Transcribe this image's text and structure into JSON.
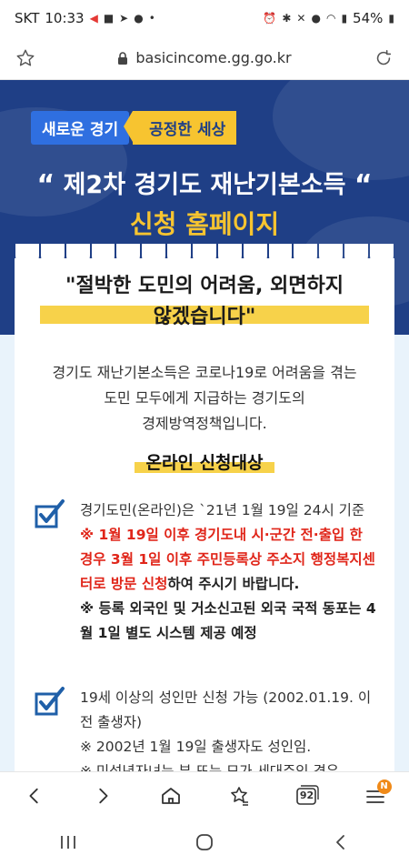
{
  "status_bar": {
    "carrier": "SKT",
    "time": "10:33",
    "battery": "54%"
  },
  "browser": {
    "url": "basicincome.gg.go.kr",
    "tab_count": "92",
    "notification_badge": "N"
  },
  "hero": {
    "badge_left": "새로운 경기",
    "badge_right": "공정한 세상",
    "title_open_quote": "“",
    "title": "제2차 경기도 재난기본소득",
    "title_close_quote": "“",
    "subtitle": "신청 홈페이지"
  },
  "slogan": {
    "line1": "\"절박한 도민의 어려움, 외면하지",
    "line2": "않겠습니다\""
  },
  "intro": {
    "line1": "경기도 재난기본소득은 코로나19로 어려움을 겪는",
    "line2": "도민 모두에게 지급하는 경기도의",
    "line3": "경제방역정책입니다."
  },
  "online_target": {
    "title": "온라인 신청대상",
    "item1": {
      "line1": "경기도민(온라인)은 `21년 1월 19일 24시 기준",
      "warning": "※ 1월 19일 이후 경기도내 시·군간 전·출입 한 경우 3월 1일 이후 주민등록상 주소지 행정복지센터로 방문 신청",
      "warning_suffix": "하여 주시기 바랍니다.",
      "note": "※ 등록 외국인 및 거소신고된 외국 국적 동포는 4월 1일 별도 시스템 제공 예정"
    },
    "item2": {
      "line1": "19세 이상의 성인만 신청 가능 (2002.01.19. 이전 출생자)",
      "line2": "※ 2002년 1월 19일 출생자도 성인임.",
      "line3": "※ 미성년자녀는 부 또는 모가 세대주인 경우"
    }
  },
  "colors": {
    "hero_bg": "#1f3f86",
    "accent_yellow": "#f7c430",
    "badge_blue": "#2f6fe0",
    "warning_red": "#e0261a",
    "page_bg": "#e9f3fb"
  }
}
